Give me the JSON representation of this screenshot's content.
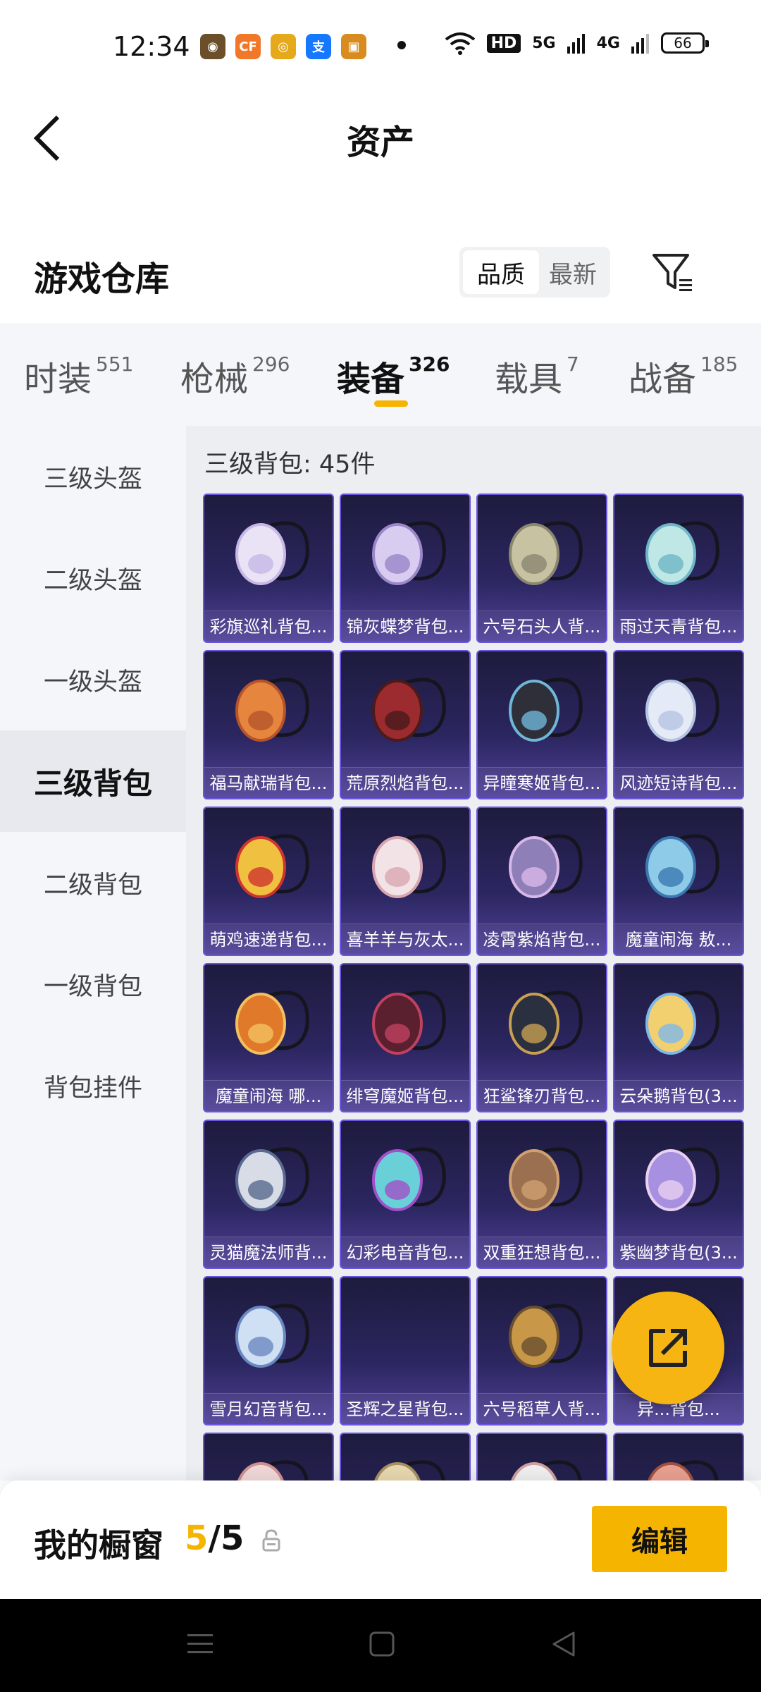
{
  "status_bar": {
    "time": "12:34",
    "apps": [
      {
        "icon": "game-app-icon",
        "color": "#6b4f2a",
        "glyph": "◉"
      },
      {
        "icon": "cf-app-icon",
        "color": "#f07828",
        "glyph": "CF"
      },
      {
        "icon": "target-app-icon",
        "color": "#e6a91b",
        "glyph": "◎"
      },
      {
        "icon": "alipay-app-icon",
        "color": "#1677ff",
        "glyph": "支"
      },
      {
        "icon": "store-app-icon",
        "color": "#d88b1e",
        "glyph": "▣"
      }
    ],
    "hd_label": "HD",
    "signal_5g": "5G",
    "signal_4g": "4G",
    "battery": "66"
  },
  "header": {
    "title": "资产"
  },
  "warehouse": {
    "title": "游戏仓库",
    "sort_options": [
      "品质",
      "最新"
    ]
  },
  "tabs": [
    {
      "label": "时装",
      "count": "551"
    },
    {
      "label": "枪械",
      "count": "296"
    },
    {
      "label": "装备",
      "count": "326"
    },
    {
      "label": "载具",
      "count": "7"
    },
    {
      "label": "战备",
      "count": "185"
    }
  ],
  "sidebar": {
    "items": [
      "三级头盔",
      "二级头盔",
      "一级头盔",
      "三级背包",
      "二级背包",
      "一级背包",
      "背包挂件"
    ]
  },
  "content": {
    "title": "三级背包: 45件",
    "items": [
      "彩旗巡礼背包...",
      "锦灰蝶梦背包...",
      "六号石头人背...",
      "雨过天青背包...",
      "福马献瑞背包...",
      "荒原烈焰背包...",
      "异瞳寒姬背包...",
      "风迹短诗背包...",
      "萌鸡速递背包...",
      "喜羊羊与灰太...",
      "凌霄紫焰背包...",
      "魔童闹海 敖...",
      "魔童闹海 哪...",
      "绯穹魔姬背包...",
      "狂鲨锋刃背包...",
      "云朵鹅背包(3...",
      "灵猫魔法师背...",
      "幻彩电音背包...",
      "双重狂想背包...",
      "紫幽梦背包(3...",
      "雪月幻音背包...",
      "圣辉之星背包...",
      "六号稻草人背...",
      "异...背包..."
    ]
  },
  "bottom_panel": {
    "title": "我的橱窗",
    "count_current": "5",
    "count_sep": "/",
    "count_total": "5",
    "edit_label": "编辑"
  },
  "colors": {
    "accent": "#f5b400",
    "card_border": "#6b55e0"
  }
}
